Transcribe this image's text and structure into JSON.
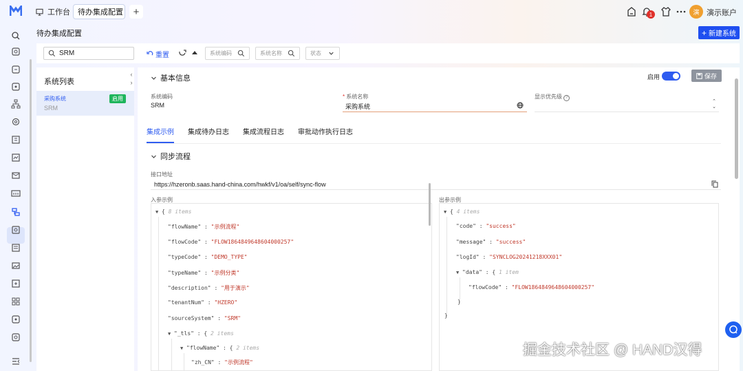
{
  "topbar": {
    "home_tab": "工作台",
    "active_tab": "待办集成配置",
    "add_tab": "+",
    "notification_count": "1",
    "user_avatar": "演",
    "user_name": "演示账户"
  },
  "page": {
    "title": "待办集成配置",
    "new_button": "新建系统"
  },
  "filter": {
    "search_value": "SRM",
    "reset_label": "重置",
    "system_code_placeholder": "系统编码",
    "system_name_placeholder": "系统名称",
    "status_placeholder": "状态"
  },
  "system_list": {
    "title": "系统列表",
    "items": [
      {
        "name": "采购系统",
        "code": "SRM",
        "status": "启用"
      }
    ]
  },
  "basic_info": {
    "section_title": "基本信息",
    "enable_label": "启用",
    "save_label": "保存",
    "system_code_label": "系统编码",
    "system_code_value": "SRM",
    "system_name_label": "系统名称",
    "system_name_value": "采购系统",
    "priority_label": "显示优先级"
  },
  "tabs": [
    "集成示例",
    "集成待办日志",
    "集成流程日志",
    "审批动作执行日志"
  ],
  "sync": {
    "section_title": "同步流程",
    "endpoint_label": "接口地址",
    "endpoint_value": "https://hzeronb.saas.hand-china.com/hwkf/v1/oa/self/sync-flow",
    "input_label": "入参示例",
    "output_label": "出参示例"
  },
  "input_json": {
    "count": "8 items",
    "fields": [
      {
        "key": "\"flowName\"",
        "value": "\"示例流程\""
      },
      {
        "key": "\"flowCode\"",
        "value": "\"FLOW1864849648604000257\""
      },
      {
        "key": "\"typeCode\"",
        "value": "\"DEMO_TYPE\""
      },
      {
        "key": "\"typeName\"",
        "value": "\"示例分类\""
      },
      {
        "key": "\"description\"",
        "value": "\"用于演示\""
      },
      {
        "key": "\"tenantNum\"",
        "value": "\"HZERO\""
      },
      {
        "key": "\"sourceSystem\"",
        "value": "\"SRM\""
      }
    ],
    "tls_key": "\"_tls\"",
    "tls_count": "2 items",
    "flowname_key": "\"flowName\"",
    "flowname_count": "2 items",
    "zh_key": "\"zh_CN\"",
    "zh_value": "\"示例流程\""
  },
  "output_json": {
    "count": "4 items",
    "code_key": "\"code\"",
    "code_value": "\"success\"",
    "message_key": "\"message\"",
    "message_value": "\"success\"",
    "logid_key": "\"logId\"",
    "logid_value": "\"SYNCLOG20241218XXX01\"",
    "data_key": "\"data\"",
    "data_count": "1 item",
    "flowcode_key": "\"flowCode\"",
    "flowcode_value": "\"FLOW1864849648604000257\""
  },
  "watermark": "掘金技术社区 @ HAND汉得",
  "colors": {
    "primary": "#2f5cf0",
    "enabled_tag": "#1fb55c",
    "string_value": "#c0392b"
  }
}
